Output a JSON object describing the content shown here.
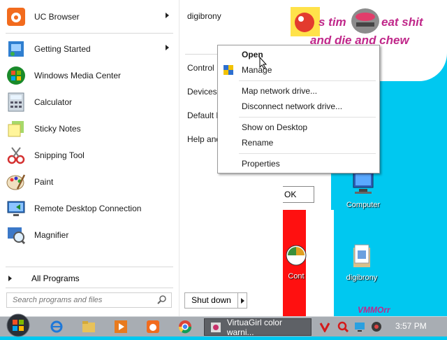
{
  "start_menu": {
    "pinned": [
      {
        "label": "UC Browser",
        "icon": "uc-browser-icon",
        "has_submenu": true
      },
      {
        "label": "Getting Started",
        "icon": "getting-started-icon",
        "has_submenu": true
      },
      {
        "label": "Windows Media Center",
        "icon": "media-center-icon",
        "has_submenu": false
      },
      {
        "label": "Calculator",
        "icon": "calculator-icon",
        "has_submenu": false
      },
      {
        "label": "Sticky Notes",
        "icon": "sticky-notes-icon",
        "has_submenu": false
      },
      {
        "label": "Snipping Tool",
        "icon": "snipping-tool-icon",
        "has_submenu": false
      },
      {
        "label": "Paint",
        "icon": "paint-icon",
        "has_submenu": false
      },
      {
        "label": "Remote Desktop Connection",
        "icon": "remote-desktop-icon",
        "has_submenu": false
      },
      {
        "label": "Magnifier",
        "icon": "magnifier-icon",
        "has_submenu": false
      }
    ],
    "all_programs": "All Programs",
    "search_placeholder": "Search programs and files",
    "shutdown_label": "Shut down",
    "right_items": [
      "digibrony",
      "Control",
      "Devices",
      "Default P",
      "Help and"
    ]
  },
  "context_menu": {
    "items": [
      "Open",
      "Manage",
      "Map network drive...",
      "Disconnect network drive...",
      "Show on Desktop",
      "Rename",
      "Properties"
    ],
    "default_item": "Open"
  },
  "desktop": {
    "scribble_lines": [
      "s tim",
      "eat shit",
      "and die and chew"
    ],
    "ok_fragment": "OK",
    "icons": [
      {
        "label": "Computer",
        "icon": "computer-icon"
      },
      {
        "label": "Cont",
        "icon": "control-panel-icon"
      },
      {
        "label": "digibrony",
        "icon": "user-folder-icon"
      }
    ],
    "corner_text": "VMMOrr"
  },
  "taskbar": {
    "active_window": "VirtuaGirl color warni...",
    "clock": "3:57 PM",
    "pinned": [
      "internet-explorer-icon",
      "explorer-icon",
      "media-player-icon",
      "uc-browser-icon",
      "chrome-icon"
    ],
    "tray": [
      "v-icon",
      "search-tray-icon",
      "monitor-tray-icon",
      "disc-tray-icon"
    ]
  },
  "colors": {
    "desktop": "#00c8f0",
    "taskbar": "#a8adb3",
    "scribble": "#c0288a",
    "red_paint": "#ff1010"
  }
}
